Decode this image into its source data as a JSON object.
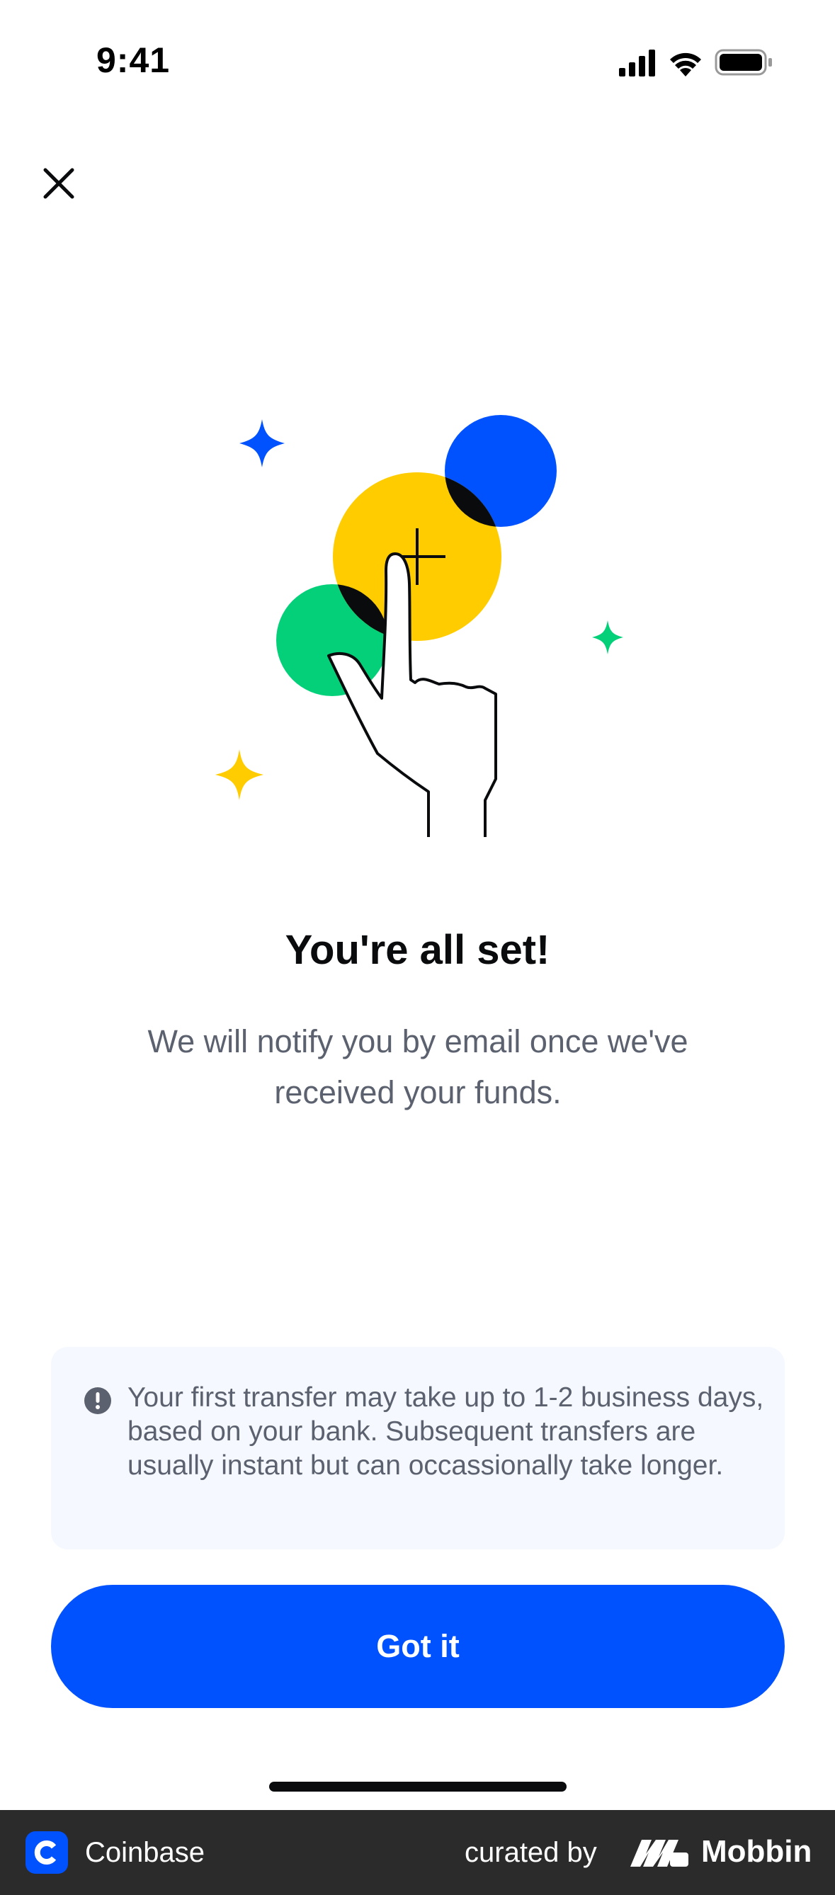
{
  "status_bar": {
    "time": "9:41",
    "icons": [
      "cellular-signal-icon",
      "wifi-icon",
      "battery-icon"
    ]
  },
  "header": {
    "close_icon": "close-icon"
  },
  "illustration": {
    "icon": "tap-to-add-hand-illustration",
    "colors": {
      "blue": "#0052ff",
      "yellow": "#ffcc00",
      "green": "#05d07a",
      "line": "#0a0b0d"
    }
  },
  "main": {
    "title": "You're all set!",
    "subtitle": "We will notify you by email once we've received your funds."
  },
  "notice": {
    "icon": "exclamation-circle-icon",
    "text": "Your first transfer may take up to 1-2 business days, based on your bank. Subsequent transfers are usually instant but can occassionally take longer."
  },
  "actions": {
    "primary_label": "Got it"
  },
  "footer": {
    "app_name": "Coinbase",
    "curated_by": "curated by",
    "brand": "Mobbin"
  },
  "colors": {
    "accent": "#0052ff",
    "notice_bg": "#f5f8ff",
    "text_primary": "#0a0b0d",
    "text_secondary": "#5b616e"
  }
}
